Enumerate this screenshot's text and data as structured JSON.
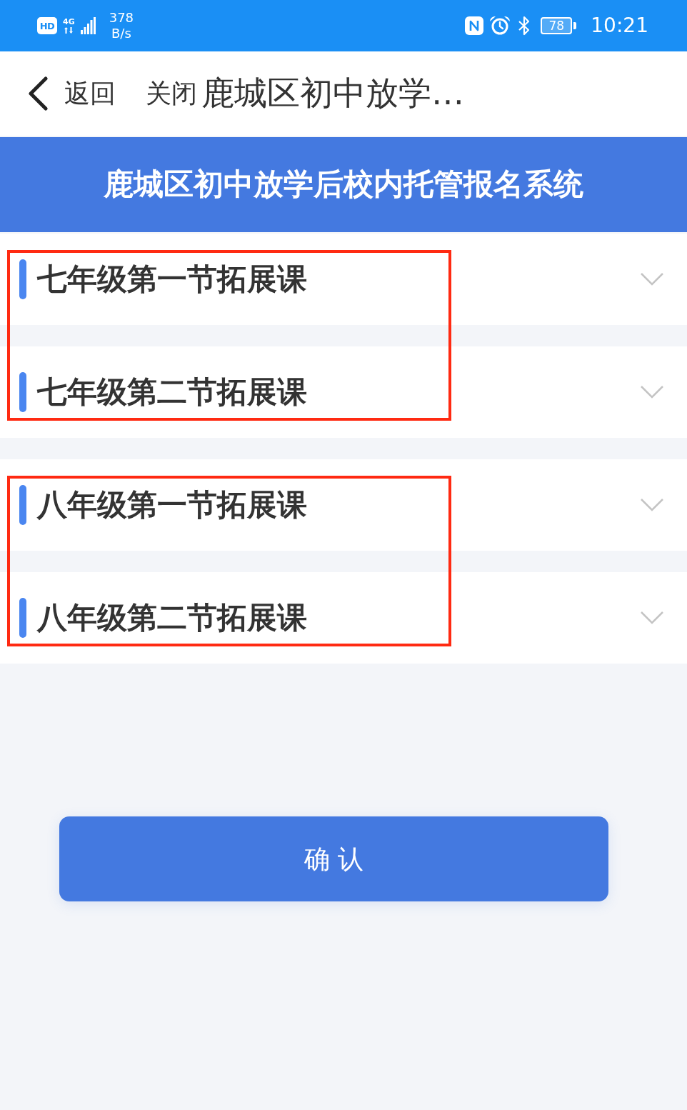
{
  "status_bar": {
    "network_badge": "HD",
    "network_type": "4G",
    "speed_value": "378",
    "speed_unit": "B/s",
    "battery": "78",
    "time": "10:21"
  },
  "nav_bar": {
    "back_label": "返回",
    "close_label": "关闭",
    "title": "鹿城区初中放学…"
  },
  "banner": {
    "title": "鹿城区初中放学后校内托管报名系统"
  },
  "sections": [
    {
      "highlighted": true,
      "items": [
        {
          "label": "七年级第一节拓展课",
          "expanded": false
        },
        {
          "label": "七年级第二节拓展课",
          "expanded": false
        }
      ]
    },
    {
      "highlighted": true,
      "items": [
        {
          "label": "八年级第一节拓展课",
          "expanded": false
        },
        {
          "label": "八年级第二节拓展课",
          "expanded": false
        }
      ]
    }
  ],
  "confirm_button": {
    "label": "确 认"
  }
}
